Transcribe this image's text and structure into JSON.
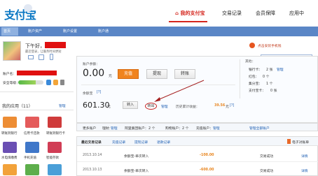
{
  "brand": {
    "logo_text": "支付宝",
    "accent": "#d4251c",
    "nav_blue": "#5a86c6"
  },
  "nav": {
    "my_alipay": "我的支付宝",
    "transactions": "交易记录",
    "membership": "会员保障",
    "apps": "应用中"
  },
  "subnav": {
    "home": "首页",
    "account_assets": "账户资产",
    "account_settings": "账户设置",
    "account_open": "账户通"
  },
  "search": {
    "placeholder": "搜索服务，如\"红包\""
  },
  "profile": {
    "greeting": "下午好，",
    "last_login": "最近登录，让服务时间更短",
    "account_label": "账户名：",
    "security_label": "安全等级："
  },
  "promo": {
    "label": "点击安装手机钱"
  },
  "my_apps": {
    "title": "我的应用（11）",
    "manage": "管理",
    "items": [
      "转账到银行",
      "信用卡还款",
      "转账到银行卡",
      "水电煤缴费",
      "手机充值",
      "智能存款"
    ]
  },
  "balance": {
    "label": "账户余额：",
    "value": "0.00",
    "unit": "元",
    "recharge": "充值",
    "withdraw": "提现",
    "transfer": "转账"
  },
  "others": {
    "label": "其他：",
    "rows": [
      {
        "k": "银行卡：",
        "v": "2 张",
        "link": "管理"
      },
      {
        "k": "红包：",
        "v": "0 个"
      },
      {
        "k": "集分宝：",
        "v": "1 个"
      },
      {
        "k": "支付宝卡：",
        "v": "0 张"
      }
    ]
  },
  "yuebao": {
    "label": "余额宝",
    "info": "[?]",
    "value": "601.30",
    "unit": "元",
    "in": "转入",
    "out": "转出",
    "manage": "管理",
    "history_label": "历史累计收益：",
    "history_value": "39.56",
    "history_unit": "元",
    "info2": "[?]"
  },
  "more_accounts": {
    "label": "更多账户",
    "items": [
      {
        "k": "理财：",
        "v": "管理"
      },
      {
        "k": "阿里集团账户：",
        "v": "2 个"
      },
      {
        "k": "购物账户：",
        "v": "2 个"
      },
      {
        "k": "充值账户：",
        "v": "管理"
      }
    ],
    "all": "管理全部账户"
  },
  "records": {
    "tabs": [
      "最近交易记录",
      "充值记录",
      "提现记录",
      "退款记录"
    ],
    "electronic": "电子对账单",
    "rows": [
      {
        "date": "2013.10.14",
        "desc": "余额宝-单次转入",
        "amount": "-100.00",
        "status": "交易成功",
        "detail": "详情"
      },
      {
        "date": "2013.10.13",
        "desc": "余额宝-单次转入",
        "amount": "-600.00",
        "status": "交易成功",
        "detail": "详情"
      }
    ]
  }
}
